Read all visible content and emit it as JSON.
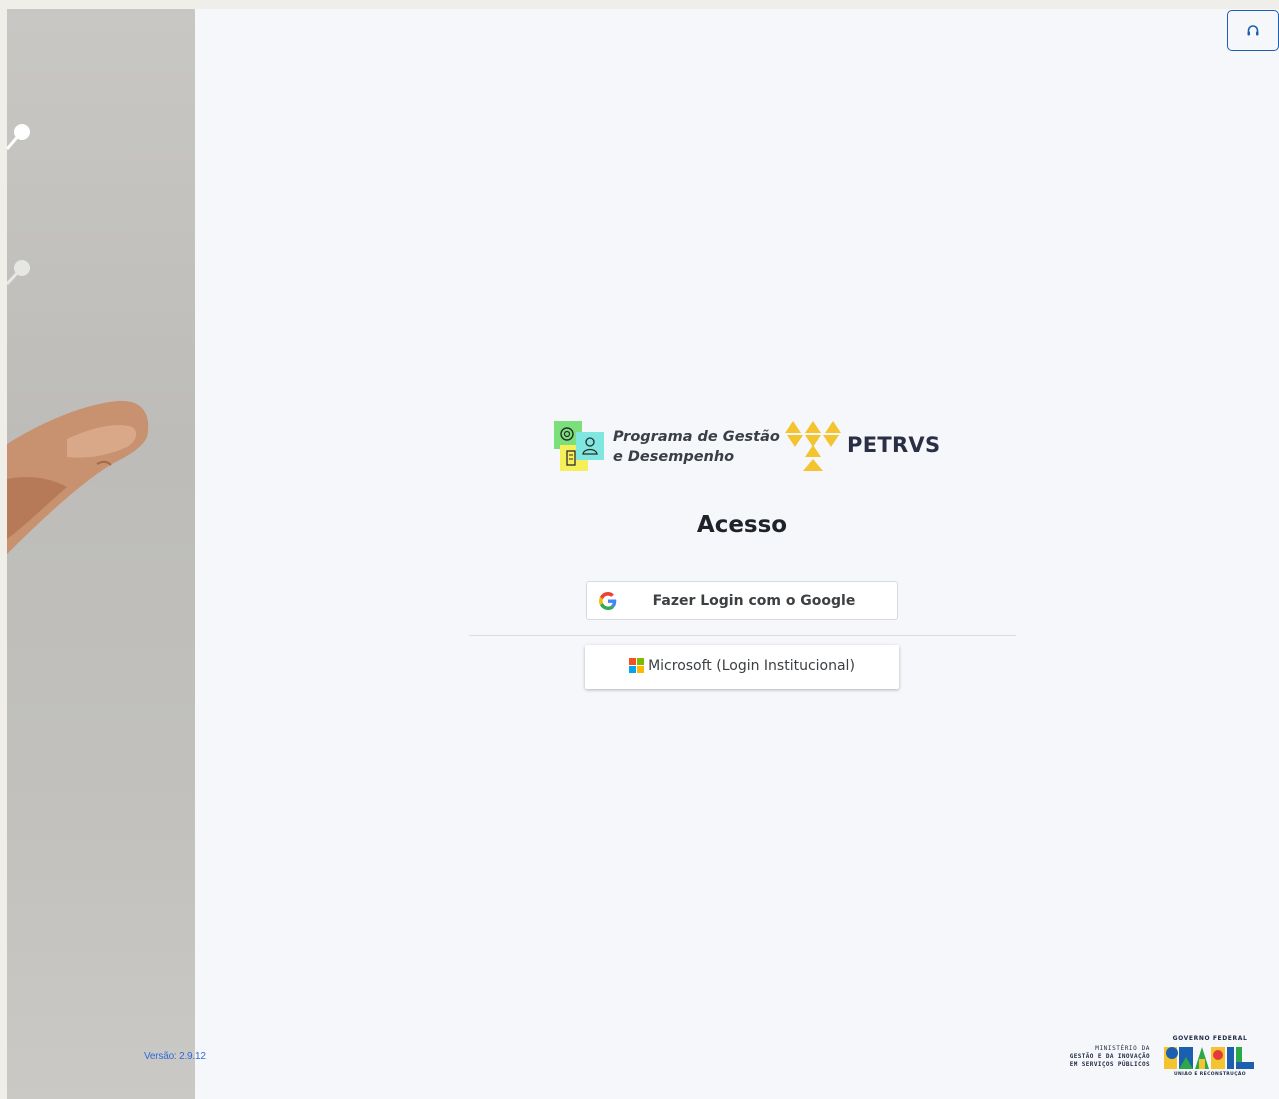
{
  "support": {
    "icon": "headset-icon",
    "border_color": "#1b5fae"
  },
  "version_label": "Versão: 2.9.12",
  "branding": {
    "program_line1": "Programa de Gestão",
    "program_line2": "e Desempenho",
    "petrvs": "PETRVS"
  },
  "login": {
    "title": "Acesso",
    "google_label": "Fazer Login com o Google",
    "microsoft_label": "Microsoft (Login Institucional)"
  },
  "footer": {
    "ministry_line1": "MINISTÉRIO DA",
    "ministry_line2": "GESTÃO E DA INOVAÇÃO",
    "ministry_line3": "EM SERVIÇOS PÚBLICOS",
    "gov_top": "GOVERNO FEDERAL",
    "gov_brand": "BRASIL",
    "gov_bottom": "UNIÃO E RECONSTRUÇÃO"
  },
  "colors": {
    "page_bg": "#f5f7fa",
    "accent_yellow": "#f4c430",
    "text_dark": "#1e2229",
    "link_blue": "#2f6bd8"
  }
}
